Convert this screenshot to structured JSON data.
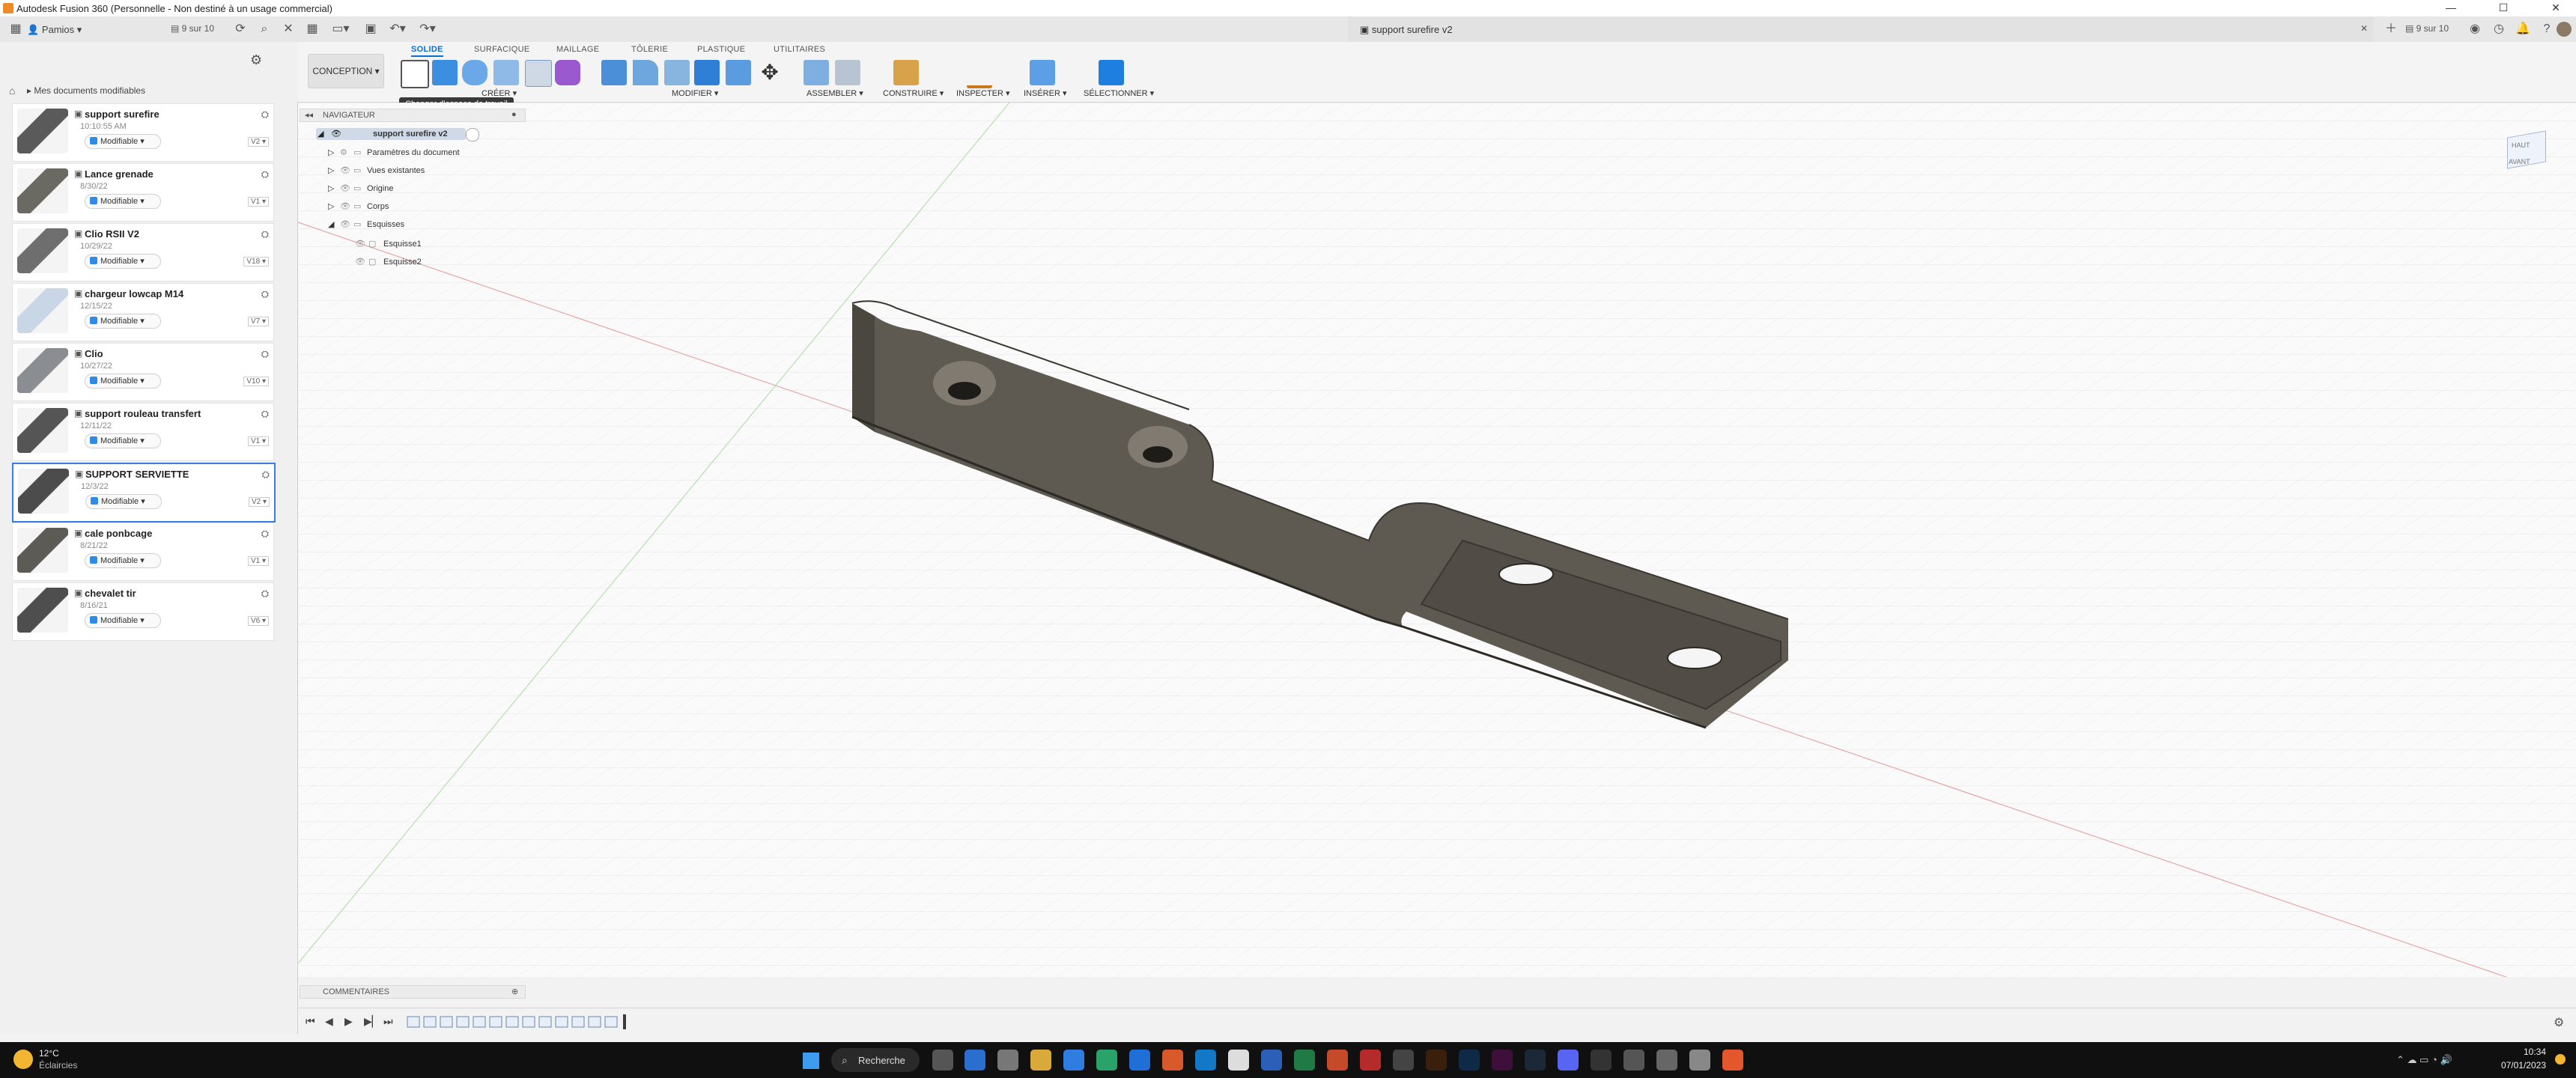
{
  "titlebar": {
    "app_title": "Autodesk Fusion 360 (Personnelle - Non destiné à un usage commercial)"
  },
  "appbar": {
    "team_name": "Pamios",
    "jobs_count_left": "9 sur 10",
    "jobs_count_right": "9 sur 10",
    "doc_tab_title": "support surefire v2"
  },
  "ribbon": {
    "workspace_button": "CONCEPTION",
    "tabs": [
      "SOLIDE",
      "SURFACIQUE",
      "MAILLAGE",
      "TÔLERIE",
      "PLASTIQUE",
      "UTILITAIRES"
    ],
    "groups": [
      "CRÉER",
      "MODIFIER",
      "ASSEMBLER",
      "CONSTRUIRE",
      "INSPECTER",
      "INSÉRER",
      "SÉLECTIONNER"
    ],
    "tooltip": "Changer d'espace de travail"
  },
  "leftpanel": {
    "breadcrumb": "Mes documents modifiables",
    "status_label": "Modifiable",
    "documents": [
      {
        "name": "support surefire",
        "date": "10:10:55 AM",
        "version": "V2"
      },
      {
        "name": "Lance grenade",
        "date": "8/30/22",
        "version": "V1"
      },
      {
        "name": "Clio RSII V2",
        "date": "10/29/22",
        "version": "V18"
      },
      {
        "name": "chargeur lowcap M14",
        "date": "12/15/22",
        "version": "V7"
      },
      {
        "name": "Clio",
        "date": "10/27/22",
        "version": "V10"
      },
      {
        "name": "support rouleau transfert",
        "date": "12/11/22",
        "version": "V1"
      },
      {
        "name": "SUPPORT SERVIETTE",
        "date": "12/3/22",
        "version": "V2"
      },
      {
        "name": "cale ponbcage",
        "date": "8/21/22",
        "version": "V1"
      },
      {
        "name": "chevalet tir",
        "date": "8/16/21",
        "version": "V6"
      }
    ]
  },
  "navigator": {
    "title": "NAVIGATEUR",
    "root": "support surefire v2",
    "nodes": [
      "Paramètres du document",
      "Vues existantes",
      "Origine",
      "Corps",
      "Esquisses"
    ],
    "sketches": [
      "Esquisse1",
      "Esquisse2"
    ]
  },
  "comments": {
    "title": "COMMENTAIRES"
  },
  "viewcube": {
    "top": "HAUT",
    "front": "AVANT"
  },
  "taskbar": {
    "weather_temp": "12°C",
    "weather_text": "Éclaircies",
    "search_label": "Recherche",
    "time": "10:34",
    "date": "07/01/2023"
  },
  "colors": {
    "accent": "#0a6fd6",
    "model": "#5e5a52",
    "taskbar": "#101010"
  }
}
